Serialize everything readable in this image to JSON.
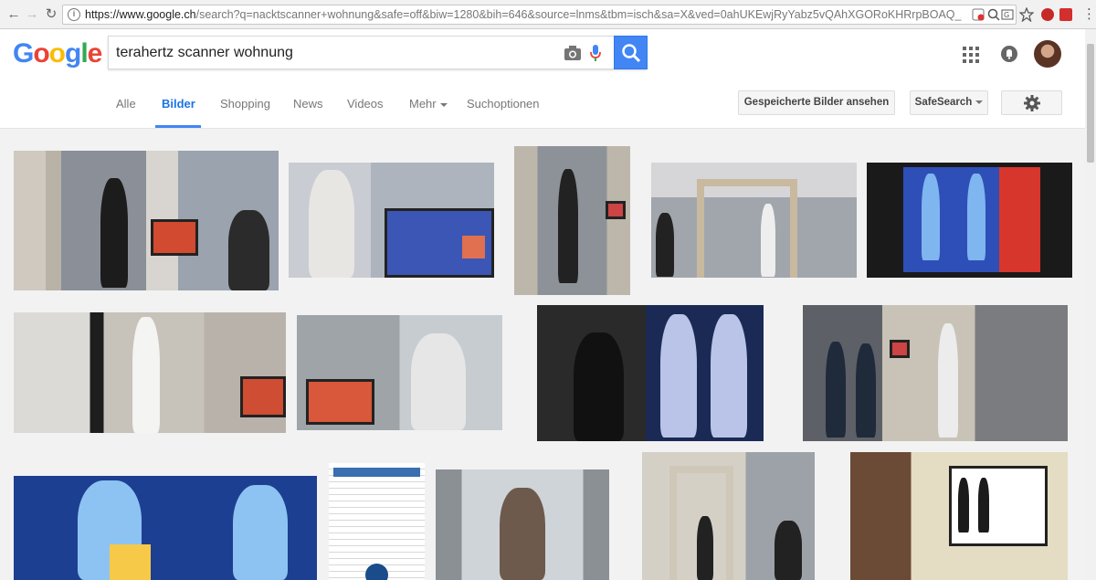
{
  "browser": {
    "url_host": "https://www.google.ch",
    "url_rest": "/search?q=nacktscanner+wohnung&safe=off&biw=1280&bih=646&source=lnms&tbm=isch&sa=X&ved=0ahUKEwjRyYabz5vQAhXGORoKHRrpBOAQ_AUIBigB#safe=off&tbm=is"
  },
  "google": {
    "logo": [
      "G",
      "o",
      "o",
      "g",
      "l",
      "e"
    ],
    "logo_colors": [
      "#4285f4",
      "#ea4335",
      "#fbbc05",
      "#4285f4",
      "#34a853",
      "#ea4335"
    ],
    "search_value": "terahertz scanner wohnung"
  },
  "tabs": {
    "all": "Alle",
    "images": "Bilder",
    "shopping": "Shopping",
    "news": "News",
    "videos": "Videos",
    "more": "Mehr",
    "tools": "Suchoptionen"
  },
  "buttons": {
    "saved_images": "Gespeicherte Bilder ansehen",
    "safesearch": "SafeSearch"
  },
  "accent": "#4285f4",
  "images": [
    {
      "alt": "Airport body scanner with attendant and monitor"
    },
    {
      "alt": "Man raising arms in front of scanner screen"
    },
    {
      "alt": "Person standing inside scanner gate"
    },
    {
      "alt": "Scanner gate in airport hall with staff"
    },
    {
      "alt": "Scanner display with two blue body silhouettes"
    },
    {
      "alt": "Person in scanner, monitor showing silhouettes"
    },
    {
      "alt": "Man with raised hands next to scanner display"
    },
    {
      "alt": "Man in scanner and full-body scan images"
    },
    {
      "alt": "Airport scanner row with officers"
    },
    {
      "alt": "Close-up blue body silhouette on display"
    },
    {
      "alt": "Article page about scanners"
    },
    {
      "alt": "Woman with raised arms inside glass scanner"
    },
    {
      "alt": "ProVision scanner gate with attendant"
    },
    {
      "alt": "Operator viewing scanner images on monitor"
    }
  ]
}
